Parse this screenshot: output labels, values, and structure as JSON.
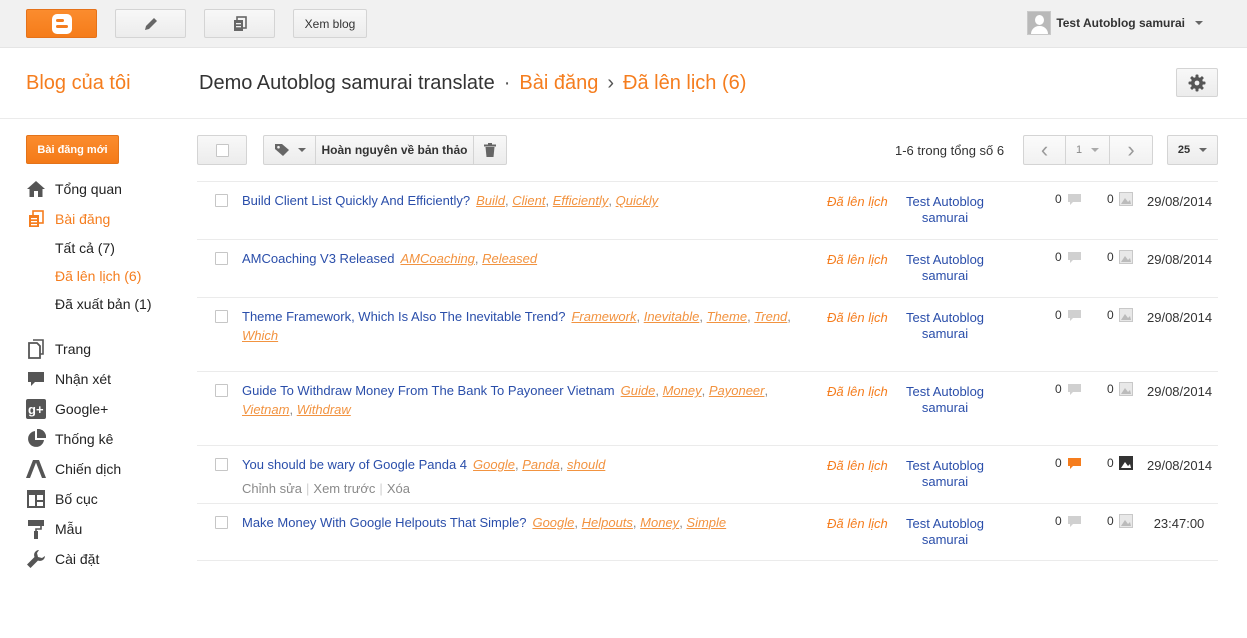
{
  "topbar": {
    "view_blog": "Xem blog",
    "user_name": "Test Autoblog samurai",
    "colors": {
      "accent": "#f57d1e",
      "bar_bg": "#f1f1f1"
    }
  },
  "header": {
    "my_blog": "Blog của tôi",
    "blog_name": "Demo Autoblog samurai translate",
    "sep1": "·",
    "section": "Bài đăng",
    "sep2": "›",
    "current": "Đã lên lịch (6)"
  },
  "sidebar": {
    "new_post": "Bài đăng mới",
    "overview": "Tổng quan",
    "posts": "Bài đăng",
    "sub": {
      "all": "Tất cả (7)",
      "scheduled": "Đã lên lịch (6)",
      "published": "Đã xuất bản (1)"
    },
    "pages": "Trang",
    "comments": "Nhận xét",
    "google_plus": "Google+",
    "stats": "Thống kê",
    "campaigns": "Chiến dịch",
    "layout": "Bố cục",
    "template": "Mẫu",
    "settings": "Cài đặt"
  },
  "toolbar": {
    "revert": "Hoàn nguyên về bản thảo",
    "count": "1-6 trong tổng số 6",
    "prev": "‹",
    "page": "1",
    "next": "›",
    "per_page": "25"
  },
  "posts": [
    {
      "title": "Build Client List Quickly And Efficiently?",
      "labels": [
        "Build",
        "Client",
        "Efficiently",
        "Quickly"
      ],
      "status": "Đã lên lịch",
      "author": "Test Autoblog samurai",
      "comments": "0",
      "views": "0",
      "date": "29/08/2014"
    },
    {
      "title": "AMCoaching V3 Released",
      "labels": [
        "AMCoaching",
        "Released"
      ],
      "status": "Đã lên lịch",
      "author": "Test Autoblog samurai",
      "comments": "0",
      "views": "0",
      "date": "29/08/2014"
    },
    {
      "title": "Theme Framework, Which Is Also The Inevitable Trend?",
      "labels": [
        "Framework",
        "Inevitable",
        "Theme",
        "Trend",
        "Which"
      ],
      "status": "Đã lên lịch",
      "author": "Test Autoblog samurai",
      "comments": "0",
      "views": "0",
      "date": "29/08/2014"
    },
    {
      "title": "Guide To Withdraw Money From The Bank To Payoneer Vietnam",
      "labels": [
        "Guide",
        "Money",
        "Payoneer",
        "Vietnam",
        "Withdraw"
      ],
      "status": "Đã lên lịch",
      "author": "Test Autoblog samurai",
      "comments": "0",
      "views": "0",
      "date": "29/08/2014"
    },
    {
      "title": "You should be wary of Google Panda 4",
      "labels": [
        "Google",
        "Panda",
        "should"
      ],
      "status": "Đã lên lịch",
      "author": "Test Autoblog samurai",
      "comments": "0",
      "views": "0",
      "date": "29/08/2014",
      "actions": {
        "edit": "Chỉnh sửa",
        "preview": "Xem trước",
        "delete": "Xóa"
      }
    },
    {
      "title": "Make Money With Google Helpouts That Simple?",
      "labels": [
        "Google",
        "Helpouts",
        "Money",
        "Simple"
      ],
      "status": "Đã lên lịch",
      "author": "Test Autoblog samurai",
      "comments": "0",
      "views": "0",
      "date": "23:47:00"
    }
  ]
}
